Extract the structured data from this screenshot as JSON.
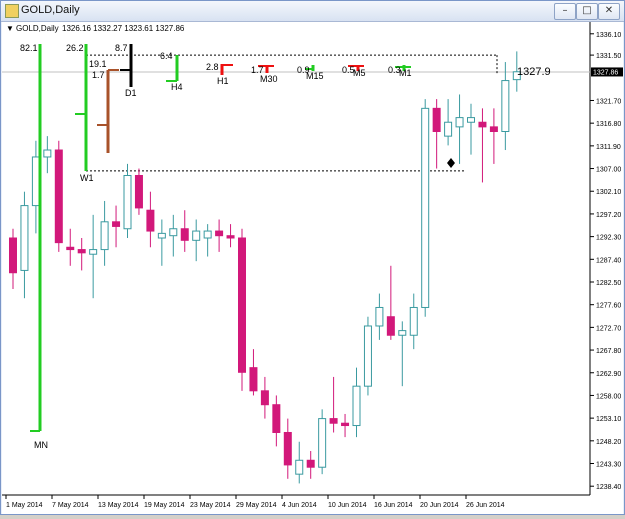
{
  "window": {
    "title": "GOLD,Daily",
    "buttons": {
      "minimize": "–",
      "maximize": "□",
      "close": "✕"
    }
  },
  "chart_header": {
    "marker": "▼",
    "symbol_label": "GOLD,Daily",
    "ohlc": "1326.16 1332.27 1323.61 1327.86"
  },
  "price_axis": {
    "labels": [
      "1336.10",
      "1331.50",
      "1327.86",
      "1321.70",
      "1316.80",
      "1311.90",
      "1307.00",
      "1302.10",
      "1297.20",
      "1292.30",
      "1287.40",
      "1282.50",
      "1277.60",
      "1272.70",
      "1267.80",
      "1262.90",
      "1258.00",
      "1253.10",
      "1248.20",
      "1243.30",
      "1238.40"
    ],
    "current_price": "1327.86"
  },
  "time_axis": {
    "labels": [
      "1 May 2014",
      "7 May 2014",
      "13 May 2014",
      "19 May 2014",
      "23 May 2014",
      "29 May 2014",
      "4 Jun 2014",
      "10 Jun 2014",
      "16 Jun 2014",
      "20 Jun 2014",
      "26 Jun 2014"
    ]
  },
  "annotations": {
    "price_tag": "1327.9",
    "timeframes": [
      {
        "label": "MN",
        "value": "82.1"
      },
      {
        "label": "W1",
        "value": "26.2",
        "sub1": "19.1",
        "sub2": "1.7"
      },
      {
        "label": "D1",
        "value": "8.7"
      },
      {
        "label": "H4",
        "value": "6.4"
      },
      {
        "label": "H1",
        "value": "2.8"
      },
      {
        "label": "M30",
        "value": "1.7"
      },
      {
        "label": "M15",
        "value": "0.9"
      },
      {
        "label": "M5",
        "value": "0.5"
      },
      {
        "label": "M1",
        "value": "0.3"
      }
    ]
  },
  "colors": {
    "bull_border": "#3a9aa0",
    "bull_fill": "#ffffff",
    "bear": "#d2187a",
    "green": "#22cc22",
    "red": "#ee1111",
    "brown": "#a8522a",
    "black": "#000000"
  },
  "chart_data": {
    "type": "candlestick",
    "symbol": "GOLD",
    "timeframe": "Daily",
    "ylim": [
      1236.5,
      1338.0
    ],
    "candles": [
      {
        "o": 1292.0,
        "h": 1294.0,
        "l": 1281.0,
        "c": 1284.5
      },
      {
        "o": 1285.0,
        "h": 1302.0,
        "l": 1279.0,
        "c": 1299.0
      },
      {
        "o": 1299.0,
        "h": 1313.0,
        "l": 1293.0,
        "c": 1309.5
      },
      {
        "o": 1309.5,
        "h": 1314.0,
        "l": 1306.0,
        "c": 1311.0
      },
      {
        "o": 1311.0,
        "h": 1313.0,
        "l": 1289.0,
        "c": 1291.0
      },
      {
        "o": 1290.0,
        "h": 1294.0,
        "l": 1286.0,
        "c": 1289.5
      },
      {
        "o": 1289.5,
        "h": 1292.0,
        "l": 1285.0,
        "c": 1288.8
      },
      {
        "o": 1288.5,
        "h": 1297.0,
        "l": 1279.0,
        "c": 1289.5
      },
      {
        "o": 1289.5,
        "h": 1300.0,
        "l": 1286.0,
        "c": 1295.5
      },
      {
        "o": 1295.5,
        "h": 1299.0,
        "l": 1290.0,
        "c": 1294.5
      },
      {
        "o": 1294.0,
        "h": 1308.0,
        "l": 1292.0,
        "c": 1305.5
      },
      {
        "o": 1305.5,
        "h": 1307.0,
        "l": 1297.0,
        "c": 1298.5
      },
      {
        "o": 1298.0,
        "h": 1302.0,
        "l": 1290.0,
        "c": 1293.5
      },
      {
        "o": 1292.0,
        "h": 1296.0,
        "l": 1286.0,
        "c": 1293.0
      },
      {
        "o": 1292.5,
        "h": 1297.0,
        "l": 1288.0,
        "c": 1294.0
      },
      {
        "o": 1294.0,
        "h": 1298.0,
        "l": 1289.0,
        "c": 1291.5
      },
      {
        "o": 1291.5,
        "h": 1296.0,
        "l": 1287.0,
        "c": 1293.5
      },
      {
        "o": 1292.0,
        "h": 1295.0,
        "l": 1288.0,
        "c": 1293.5
      },
      {
        "o": 1293.5,
        "h": 1296.0,
        "l": 1289.0,
        "c": 1292.5
      },
      {
        "o": 1292.5,
        "h": 1295.0,
        "l": 1290.0,
        "c": 1292.0
      },
      {
        "o": 1292.0,
        "h": 1294.0,
        "l": 1259.0,
        "c": 1263.0
      },
      {
        "o": 1264.0,
        "h": 1268.0,
        "l": 1258.0,
        "c": 1259.0
      },
      {
        "o": 1259.0,
        "h": 1262.0,
        "l": 1253.0,
        "c": 1256.0
      },
      {
        "o": 1256.0,
        "h": 1258.0,
        "l": 1247.0,
        "c": 1250.0
      },
      {
        "o": 1250.0,
        "h": 1253.0,
        "l": 1240.0,
        "c": 1243.0
      },
      {
        "o": 1241.0,
        "h": 1248.0,
        "l": 1239.0,
        "c": 1244.0
      },
      {
        "o": 1244.0,
        "h": 1246.0,
        "l": 1240.0,
        "c": 1242.5
      },
      {
        "o": 1242.5,
        "h": 1255.0,
        "l": 1241.0,
        "c": 1253.0
      },
      {
        "o": 1253.0,
        "h": 1262.0,
        "l": 1250.0,
        "c": 1252.0
      },
      {
        "o": 1252.0,
        "h": 1254.0,
        "l": 1249.0,
        "c": 1251.5
      },
      {
        "o": 1251.5,
        "h": 1264.0,
        "l": 1249.0,
        "c": 1260.0
      },
      {
        "o": 1260.0,
        "h": 1275.0,
        "l": 1258.0,
        "c": 1273.0
      },
      {
        "o": 1273.0,
        "h": 1280.0,
        "l": 1270.0,
        "c": 1277.0
      },
      {
        "o": 1275.0,
        "h": 1286.0,
        "l": 1270.0,
        "c": 1271.0
      },
      {
        "o": 1271.0,
        "h": 1274.0,
        "l": 1260.0,
        "c": 1272.0
      },
      {
        "o": 1271.0,
        "h": 1280.0,
        "l": 1268.0,
        "c": 1277.0
      },
      {
        "o": 1277.0,
        "h": 1322.0,
        "l": 1275.0,
        "c": 1320.0
      },
      {
        "o": 1320.0,
        "h": 1322.0,
        "l": 1307.0,
        "c": 1315.0
      },
      {
        "o": 1314.0,
        "h": 1322.0,
        "l": 1312.0,
        "c": 1317.0
      },
      {
        "o": 1316.0,
        "h": 1323.0,
        "l": 1308.0,
        "c": 1318.0
      },
      {
        "o": 1317.0,
        "h": 1321.0,
        "l": 1310.0,
        "c": 1318.0
      },
      {
        "o": 1317.0,
        "h": 1320.0,
        "l": 1304.0,
        "c": 1316.0
      },
      {
        "o": 1316.0,
        "h": 1320.0,
        "l": 1308.0,
        "c": 1315.0
      },
      {
        "o": 1315.0,
        "h": 1330.0,
        "l": 1311.0,
        "c": 1326.0
      },
      {
        "o": 1326.2,
        "h": 1332.3,
        "l": 1323.6,
        "c": 1327.9
      }
    ],
    "dotted_levels": [
      1331.5,
      1306.5
    ],
    "current_price": 1327.86
  }
}
